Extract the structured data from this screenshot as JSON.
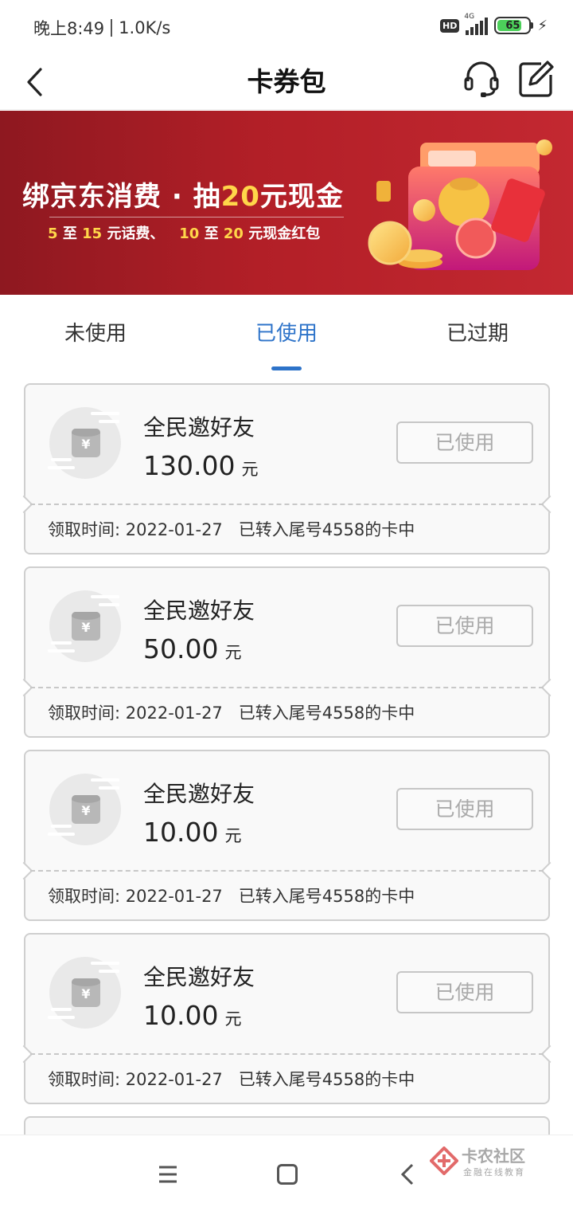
{
  "status_bar": {
    "time": "晚上8:49",
    "net_speed": "1.0K/s",
    "hd": "HD",
    "network": "4G",
    "battery": "65"
  },
  "nav": {
    "title": "卡券包"
  },
  "banner": {
    "title_part1": "绑京东消费 · 抽",
    "title_amount": "20",
    "title_part2": "元现金",
    "sub_a1": "5",
    "sub_a2": "至",
    "sub_a3": "15",
    "sub_a4": "元话费、",
    "sub_b1": "10",
    "sub_b2": "至",
    "sub_b3": "20",
    "sub_b4": "元现金红包"
  },
  "tabs": [
    {
      "label": "未使用"
    },
    {
      "label": "已使用"
    },
    {
      "label": "已过期"
    }
  ],
  "coupons": [
    {
      "name": "全民邀好友",
      "amount": "130.00",
      "unit": "元",
      "status": "已使用",
      "received_label": "领取时间: 2022-01-27",
      "note": "已转入尾号4558的卡中"
    },
    {
      "name": "全民邀好友",
      "amount": "50.00",
      "unit": "元",
      "status": "已使用",
      "received_label": "领取时间: 2022-01-27",
      "note": "已转入尾号4558的卡中"
    },
    {
      "name": "全民邀好友",
      "amount": "10.00",
      "unit": "元",
      "status": "已使用",
      "received_label": "领取时间: 2022-01-27",
      "note": "已转入尾号4558的卡中"
    },
    {
      "name": "全民邀好友",
      "amount": "10.00",
      "unit": "元",
      "status": "已使用",
      "received_label": "领取时间: 2022-01-27",
      "note": "已转入尾号4558的卡中"
    }
  ],
  "watermark": {
    "main": "卡农社区",
    "sub": "金融在线教育"
  }
}
